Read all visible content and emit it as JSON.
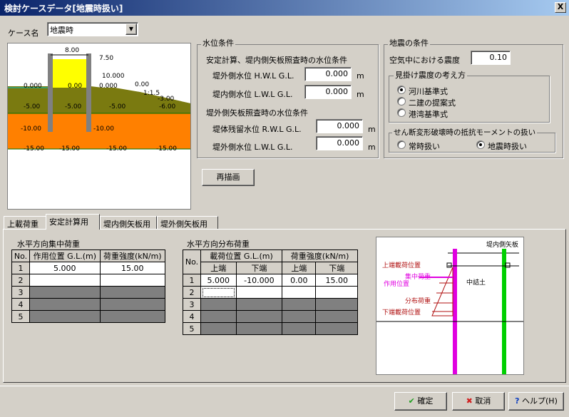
{
  "window": {
    "title": "検討ケースデータ[地震時扱い]",
    "close": "X"
  },
  "case": {
    "label": "ケース名",
    "value": "地震時"
  },
  "preview": {
    "labels": [
      "8.00",
      "7.50",
      "10.000",
      "0.00",
      "0.000",
      "0.000",
      "0.00",
      "1:1.5",
      "-3.00",
      "-5.00",
      "-5.00",
      "-5.00",
      "-6.00",
      "-10.00",
      "-10.00",
      "-15.00",
      "-15.00",
      "-15.00",
      "-15.00"
    ]
  },
  "water": {
    "title": "水位条件",
    "sub1": "安定計算、堤内側矢板照査時の水位条件",
    "hwl_label": "堤外側水位 H.W.L  G.L.",
    "hwl_value": "0.000",
    "lwl_label": "堤内側水位 L.W.L  G.L.",
    "lwl_value": "0.000",
    "sub2": "堤外側矢板照査時の水位条件",
    "rwl_label": "堤体残留水位 R.W.L  G.L.",
    "rwl_value": "0.000",
    "lwl2_label": "堤外側水位    L.W.L  G.L.",
    "lwl2_value": "0.000",
    "unit": "m"
  },
  "quake": {
    "title": "地震の条件",
    "air_label": "空気中における震度",
    "air_value": "0.10",
    "method_title": "見掛け震度の考え方",
    "methods": [
      "河川基準式",
      "二建の提案式",
      "港湾基準式"
    ],
    "moment_title": "せん断変形破壊時の抵抗モーメントの扱い",
    "moments": [
      "常時扱い",
      "地震時扱い"
    ]
  },
  "redraw": "再描画",
  "tabs": [
    "上載荷重",
    "安定計算用",
    "堤内側矢板用",
    "堤外側矢板用"
  ],
  "conc": {
    "title": "水平方向集中荷重",
    "headers": [
      "No.",
      "作用位置 G.L.(m)",
      "荷重強度(kN/m)"
    ],
    "rows": [
      [
        "1",
        "5.000",
        "15.00"
      ],
      [
        "2",
        "",
        ""
      ],
      [
        "3",
        "",
        ""
      ],
      [
        "4",
        "",
        ""
      ],
      [
        "5",
        "",
        ""
      ]
    ]
  },
  "dist": {
    "title": "水平方向分布荷重",
    "group1": "載荷位置 G.L.(m)",
    "group2": "荷重強度(kN/m)",
    "no": "No.",
    "sub": [
      "上端",
      "下端",
      "上端",
      "下端"
    ],
    "rows": [
      [
        "1",
        "5.000",
        "-10.000",
        "0.00",
        "15.00"
      ],
      [
        "2",
        "",
        "",
        "",
        ""
      ],
      [
        "3",
        "",
        "",
        "",
        ""
      ],
      [
        "4",
        "",
        "",
        "",
        ""
      ],
      [
        "5",
        "",
        "",
        "",
        ""
      ]
    ]
  },
  "fig": {
    "sheet": "堤内側矢板",
    "top": "上端載荷位置",
    "conc": "集中荷重",
    "pos": "作用位置",
    "dist": "分布荷重",
    "bottom": "下端載荷位置",
    "fill": "中詰土"
  },
  "buttons": {
    "ok": "確定",
    "cancel": "取消",
    "help": "ヘルプ(H)"
  }
}
